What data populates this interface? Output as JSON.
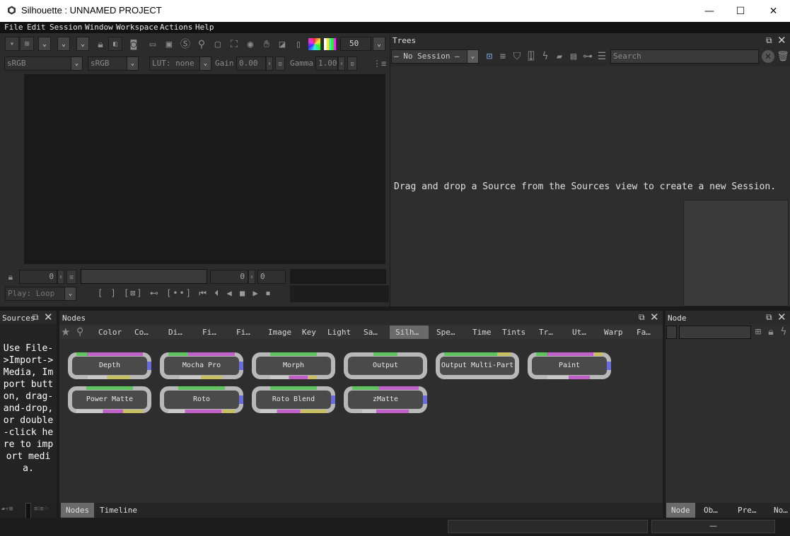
{
  "window": {
    "title": "Silhouette : UNNAMED PROJECT",
    "minimize": "—",
    "maximize": "☐",
    "close": "✕"
  },
  "menu": [
    "File",
    "Edit",
    "Session",
    "Window",
    "Workspace",
    "Actions",
    "Help"
  ],
  "viewer": {
    "zoom_value": "50",
    "colorspace_1": "sRGB",
    "colorspace_2": "sRGB",
    "lut": "LUT: none",
    "gain_label": "Gain",
    "gain_value": "0.00",
    "gamma_label": "Gamma",
    "gamma_value": "1.00",
    "frame_in": "0",
    "frame_current": "0",
    "frame_out": "0",
    "play_mode": "Play: Loop"
  },
  "trees": {
    "header": "Trees",
    "session_select": "— No Session —",
    "search_placeholder": "Search",
    "empty_message": "Drag and drop a Source from the Sources view to create a new Session."
  },
  "sources": {
    "header": "Sources",
    "help_text": "Use File->Import->Media, Import button, drag-and-drop, or double-click here to import media."
  },
  "nodes": {
    "header": "Nodes",
    "categories": [
      "Color",
      "Co…",
      "Di…",
      "Fi…",
      "Fi…",
      "Image",
      "Key",
      "Light",
      "Sa…",
      "Silh…",
      "Spe…",
      "Time",
      "Tints",
      "Tr…",
      "Ut…",
      "Warp",
      "Fa…"
    ],
    "active_category": "Silh…",
    "items": [
      "Depth",
      "Mocha Pro",
      "Morph",
      "Output",
      "Output Multi-Part",
      "Paint",
      "Power Matte",
      "Roto",
      "Roto Blend",
      "zMatte"
    ],
    "bottom_tabs": [
      "Nodes",
      "Timeline"
    ],
    "active_bottom_tab": "Nodes"
  },
  "node_panel": {
    "header": "Node",
    "bottom_tabs": [
      "Node",
      "Ob…",
      "Pre…",
      "No…"
    ],
    "active_bottom_tab": "Node",
    "status_text": "—"
  },
  "colors": {
    "accent_green": "#5fc35f",
    "accent_magenta": "#c060c8",
    "accent_yellow": "#c8c060",
    "accent_blue": "#6a6ad8",
    "panel_bg": "#2e2e2e",
    "viewer_bg": "#1a1a1a"
  }
}
